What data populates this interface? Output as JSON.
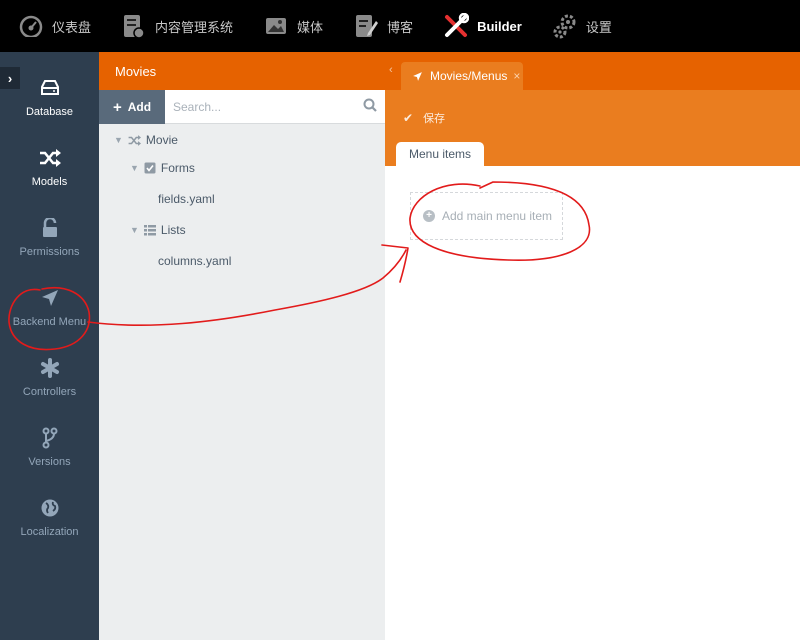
{
  "topnav": {
    "items": [
      {
        "label": "仪表盘",
        "icon": "dashboard-icon"
      },
      {
        "label": "内容管理系统",
        "icon": "cms-icon"
      },
      {
        "label": "媒体",
        "icon": "media-icon"
      },
      {
        "label": "博客",
        "icon": "blog-icon"
      },
      {
        "label": "Builder",
        "icon": "builder-icon"
      },
      {
        "label": "设置",
        "icon": "settings-icon"
      }
    ]
  },
  "sidebar": {
    "collapse_icon": "chevron-right-icon",
    "items": [
      {
        "label": "Database",
        "icon": "database-icon"
      },
      {
        "label": "Models",
        "icon": "random-icon"
      },
      {
        "label": "Permissions",
        "icon": "unlock-icon"
      },
      {
        "label": "Backend Menu",
        "icon": "location-arrow-icon"
      },
      {
        "label": "Controllers",
        "icon": "asterisk-icon"
      },
      {
        "label": "Versions",
        "icon": "code-fork-icon"
      },
      {
        "label": "Localization",
        "icon": "globe-icon"
      }
    ]
  },
  "midpanel": {
    "title": "Movies",
    "add_label": "Add",
    "search_placeholder": "Search...",
    "tree": [
      {
        "label": "Movie",
        "icon": "random-icon"
      },
      {
        "label": "Forms",
        "icon": "check-square-icon"
      },
      {
        "label": "fields.yaml"
      },
      {
        "label": "Lists",
        "icon": "list-icon"
      },
      {
        "label": "columns.yaml"
      }
    ]
  },
  "editor": {
    "tab_label": "Movies/Menus",
    "tab_close": "×",
    "save_label": "保存",
    "subtab_label": "Menu items",
    "add_menu_label": "Add main menu item"
  },
  "colors": {
    "accent": "#e66200",
    "toolbar": "#ea7d1f",
    "sidebar": "#2e3e4f",
    "annotation": "#e21b1b"
  }
}
